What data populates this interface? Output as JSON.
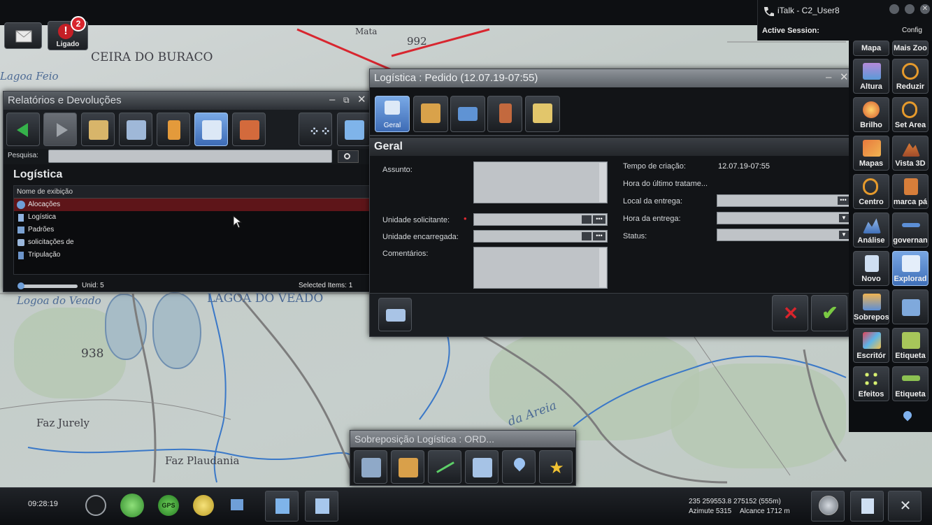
{
  "topbar": {
    "app_title": "iTalk - C2_User8",
    "active_session_label": "Active Session:",
    "config_label": "Config",
    "mail_icon": "envelope-icon",
    "alert": {
      "label": "Ligado",
      "count": "2"
    }
  },
  "map": {
    "labels": [
      "CEIRA DO BURACO",
      "992",
      "Mata",
      "LAGOA DO VEADO",
      "Logoa do Veado",
      "938",
      "Faz Jurely",
      "Faz Plaudania",
      "da Areia",
      "Lagoa Feio"
    ]
  },
  "reports_window": {
    "title": "Relatórios e Devoluções",
    "search_label": "Pesquisa:",
    "search_value": "",
    "section_title": "Logística",
    "column_header": "Nome de exibição",
    "items": [
      {
        "label": "Alocações",
        "icon": "globe-icon"
      },
      {
        "label": "Logística",
        "icon": "document-icon"
      },
      {
        "label": "Padrões",
        "icon": "pattern-icon"
      },
      {
        "label": "solicitações de",
        "icon": "request-icon"
      },
      {
        "label": "Tripulação",
        "icon": "crew-icon"
      }
    ],
    "footer_unit": "Unid: 5",
    "footer_selected": "Selected Items: 1"
  },
  "order_window": {
    "title": "Logística : Pedido (12.07.19-07:55)",
    "tabs": [
      {
        "label": "Geral",
        "icon": "general-icon",
        "active": true
      },
      {
        "label": "",
        "icon": "box-icon",
        "active": false
      },
      {
        "label": "",
        "icon": "truck-icon",
        "active": false
      },
      {
        "label": "",
        "icon": "tools-icon",
        "active": false
      },
      {
        "label": "",
        "icon": "add-folder-icon",
        "active": false
      }
    ],
    "section_title": "Geral",
    "left_fields": {
      "assunto": "Assunto:",
      "unidade_solicitante": "Unidade solicitante:",
      "unidade_encarregada": "Unidade encarregada:",
      "comentarios": "Comentários:"
    },
    "right_fields": {
      "tempo_criacao_label": "Tempo de criação:",
      "tempo_criacao_value": "12.07.19-07:55",
      "hora_ultimo_label": "Hora do último tratame...",
      "local_entrega_label": "Local da entrega:",
      "hora_entrega_label": "Hora da entrega:",
      "status_label": "Status:"
    }
  },
  "overlay_window": {
    "title": "Sobreposição Logística : ORD..."
  },
  "right_toolbar": [
    {
      "label": "Mapa",
      "icon": "map-icon"
    },
    {
      "label": "Mais Zoo",
      "icon": "zoom-in-icon"
    },
    {
      "label": "Altura",
      "icon": "height-icon"
    },
    {
      "label": "Reduzir",
      "icon": "zoom-out-icon"
    },
    {
      "label": "Brilho",
      "icon": "brightness-icon"
    },
    {
      "label": "Set Area",
      "icon": "set-area-icon"
    },
    {
      "label": "Mapas",
      "icon": "maps-icon"
    },
    {
      "label": "Vista 3D",
      "icon": "view-3d-icon"
    },
    {
      "label": "Centro",
      "icon": "center-icon"
    },
    {
      "label": "marca pá",
      "icon": "bookmark-icon"
    },
    {
      "label": "Análise",
      "icon": "analysis-icon"
    },
    {
      "label": "governan",
      "icon": "governance-icon"
    },
    {
      "label": "Novo",
      "icon": "new-icon"
    },
    {
      "label": "Explorad",
      "icon": "explorer-icon",
      "active": true
    },
    {
      "label": "Sobrepos",
      "icon": "overlay-icon"
    },
    {
      "label": "",
      "icon": "window-icon"
    },
    {
      "label": "Escritór",
      "icon": "desktop-icon"
    },
    {
      "label": "Etiqueta",
      "icon": "label-icon"
    },
    {
      "label": "Efeitos",
      "icon": "effects-icon"
    },
    {
      "label": "Etiqueta",
      "icon": "label-icon"
    }
  ],
  "statusbar": {
    "clock": "09:28:19",
    "coords": "235 259553.8 275152 (555m)",
    "azimuth": "Azimute 5315",
    "range": "Alcance 1712 m",
    "gps_label": "GPS"
  },
  "colors": {
    "active_blue": "#4a7cc4",
    "cancel_red": "#d8242c",
    "confirm_green": "#7ac943",
    "selection_red": "#5e1519",
    "road_red": "#d8262f"
  }
}
